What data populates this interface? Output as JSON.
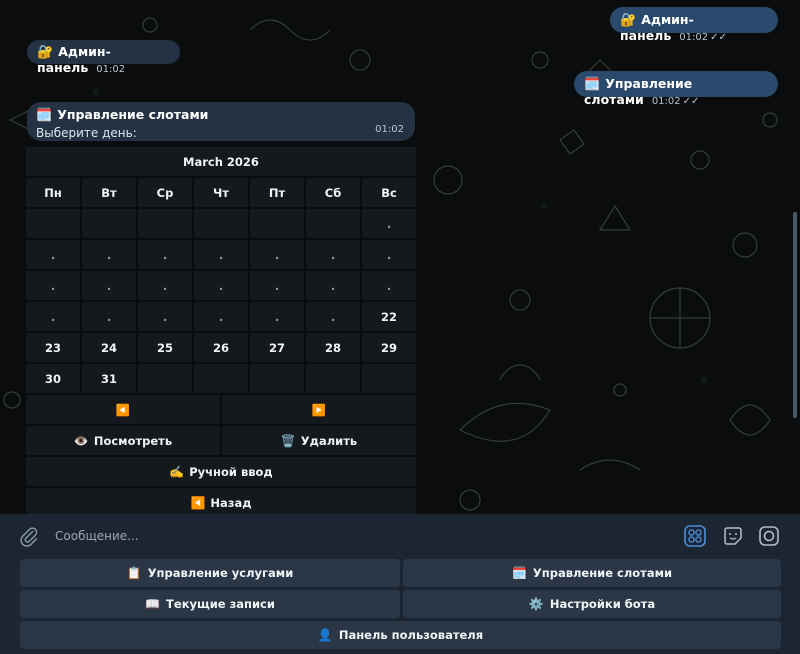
{
  "messages": {
    "m1": {
      "emoji": "🔐",
      "text": "Админ-панель",
      "time": "01:02"
    },
    "m2": {
      "emoji": "🔐",
      "text": "Админ-панель",
      "time": "01:02",
      "checks": "✓✓"
    },
    "m3": {
      "emoji": "🗓️",
      "text": "Управление слотами",
      "time": "01:02",
      "checks": "✓✓"
    },
    "m4": {
      "emoji": "🗓️",
      "title": "Управление слотами",
      "subtitle": "Выберите день:",
      "time": "01:02"
    }
  },
  "calendar": {
    "month": "March 2026",
    "weekdays": [
      "Пн",
      "Вт",
      "Ср",
      "Чт",
      "Пт",
      "Сб",
      "Вс"
    ],
    "weeks": [
      [
        " ",
        " ",
        " ",
        " ",
        " ",
        " ",
        "."
      ],
      [
        ".",
        ".",
        ".",
        ".",
        ".",
        ".",
        "."
      ],
      [
        ".",
        ".",
        ".",
        ".",
        ".",
        ".",
        "."
      ],
      [
        ".",
        ".",
        ".",
        ".",
        ".",
        ".",
        "22"
      ],
      [
        "23",
        "24",
        "25",
        "26",
        "27",
        "28",
        "29"
      ],
      [
        "30",
        "31",
        " ",
        " ",
        " ",
        " ",
        " "
      ]
    ],
    "prev": "◀️",
    "next": "▶️",
    "view": {
      "emoji": "👁️",
      "label": "Посмотреть"
    },
    "delete": {
      "emoji": "🗑️",
      "label": "Удалить"
    },
    "manual": {
      "emoji": "✍️",
      "label": "Ручной ввод"
    },
    "back": {
      "emoji": "◀️",
      "label": "Назад"
    }
  },
  "composer": {
    "placeholder": "Сообщение..."
  },
  "reply_keyboard": {
    "services": {
      "emoji": "📋",
      "label": "Управление услугами"
    },
    "slots": {
      "emoji": "🗓️",
      "label": "Управление слотами"
    },
    "bookings": {
      "emoji": "📖",
      "label": "Текущие записи"
    },
    "settings": {
      "emoji": "⚙️",
      "label": "Настройки бота"
    },
    "user_panel": {
      "emoji": "👤",
      "label": "Панель пользователя"
    }
  }
}
